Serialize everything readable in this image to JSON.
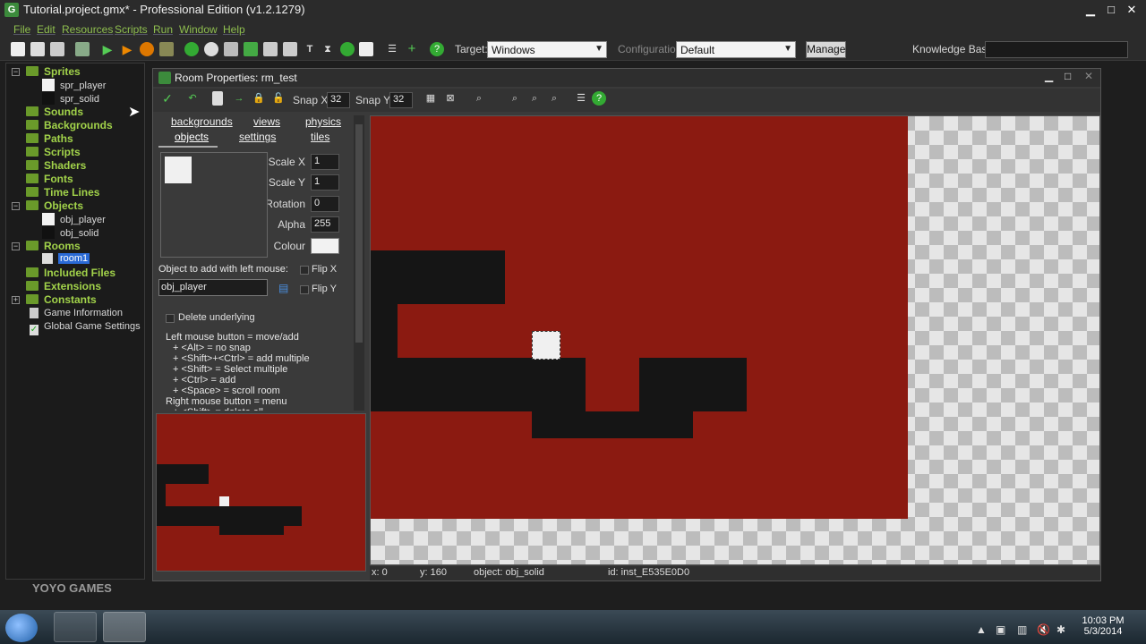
{
  "window": {
    "title": "Tutorial.project.gmx* - Professional Edition (v1.2.1279)",
    "app_icon": "gm-icon"
  },
  "menu": [
    "File",
    "Edit",
    "Resources",
    "Scripts",
    "Run",
    "Window",
    "Help"
  ],
  "toolbar": {
    "target_label": "Target:",
    "target_value": "Windows",
    "config_label": "Configuration",
    "config_value": "Default",
    "manage_label": "Manage",
    "kb_label": "Knowledge Base:"
  },
  "tree": {
    "sprites": "Sprites",
    "spr_player": "spr_player",
    "spr_solid": "spr_solid",
    "sounds": "Sounds",
    "backgrounds": "Backgrounds",
    "paths": "Paths",
    "scripts": "Scripts",
    "shaders": "Shaders",
    "fonts": "Fonts",
    "timelines": "Time Lines",
    "objects": "Objects",
    "obj_player": "obj_player",
    "obj_solid": "obj_solid",
    "rooms": "Rooms",
    "room1": "room1",
    "included_files": "Included Files",
    "extensions": "Extensions",
    "constants": "Constants",
    "game_information": "Game Information",
    "global_settings": "Global Game Settings"
  },
  "room": {
    "title": "Room Properties: rm_test",
    "snap_x_label": "Snap X:",
    "snap_x": "32",
    "snap_y_label": "Snap Y:",
    "snap_y": "32",
    "tabs": [
      "backgrounds",
      "views",
      "physics",
      "objects",
      "settings",
      "tiles"
    ],
    "scale_x_label": "Scale X",
    "scale_x": "1",
    "scale_y_label": "Scale Y",
    "scale_y": "1",
    "rotation_label": "Rotation",
    "rotation": "0",
    "alpha_label": "Alpha",
    "alpha": "255",
    "colour_label": "Colour",
    "object_add_label": "Object to add with left mouse:",
    "object_add_value": "obj_player",
    "flip_x": "Flip X",
    "flip_y": "Flip Y",
    "delete_underlying": "Delete underlying",
    "help": [
      "Left mouse button = move/add",
      "+ <Alt> = no snap",
      "+ <Shift>+<Ctrl> = add multiple",
      "+ <Shift> = Select multiple",
      "+ <Ctrl> = add",
      "+ <Space> = scroll room",
      "Right mouse button = menu",
      "+ <Shift> = delete all"
    ],
    "status": {
      "x": "x: 0",
      "y": "y: 160",
      "object": "object: obj_solid",
      "id": "id: inst_E535E0D0"
    }
  },
  "branding": "YOYO GAMES",
  "taskbar": {
    "time": "10:03 PM",
    "date": "5/3/2014"
  },
  "colors": {
    "room_bg": "#8b1a11",
    "solid": "#151515",
    "accent": "#a2d34a"
  }
}
